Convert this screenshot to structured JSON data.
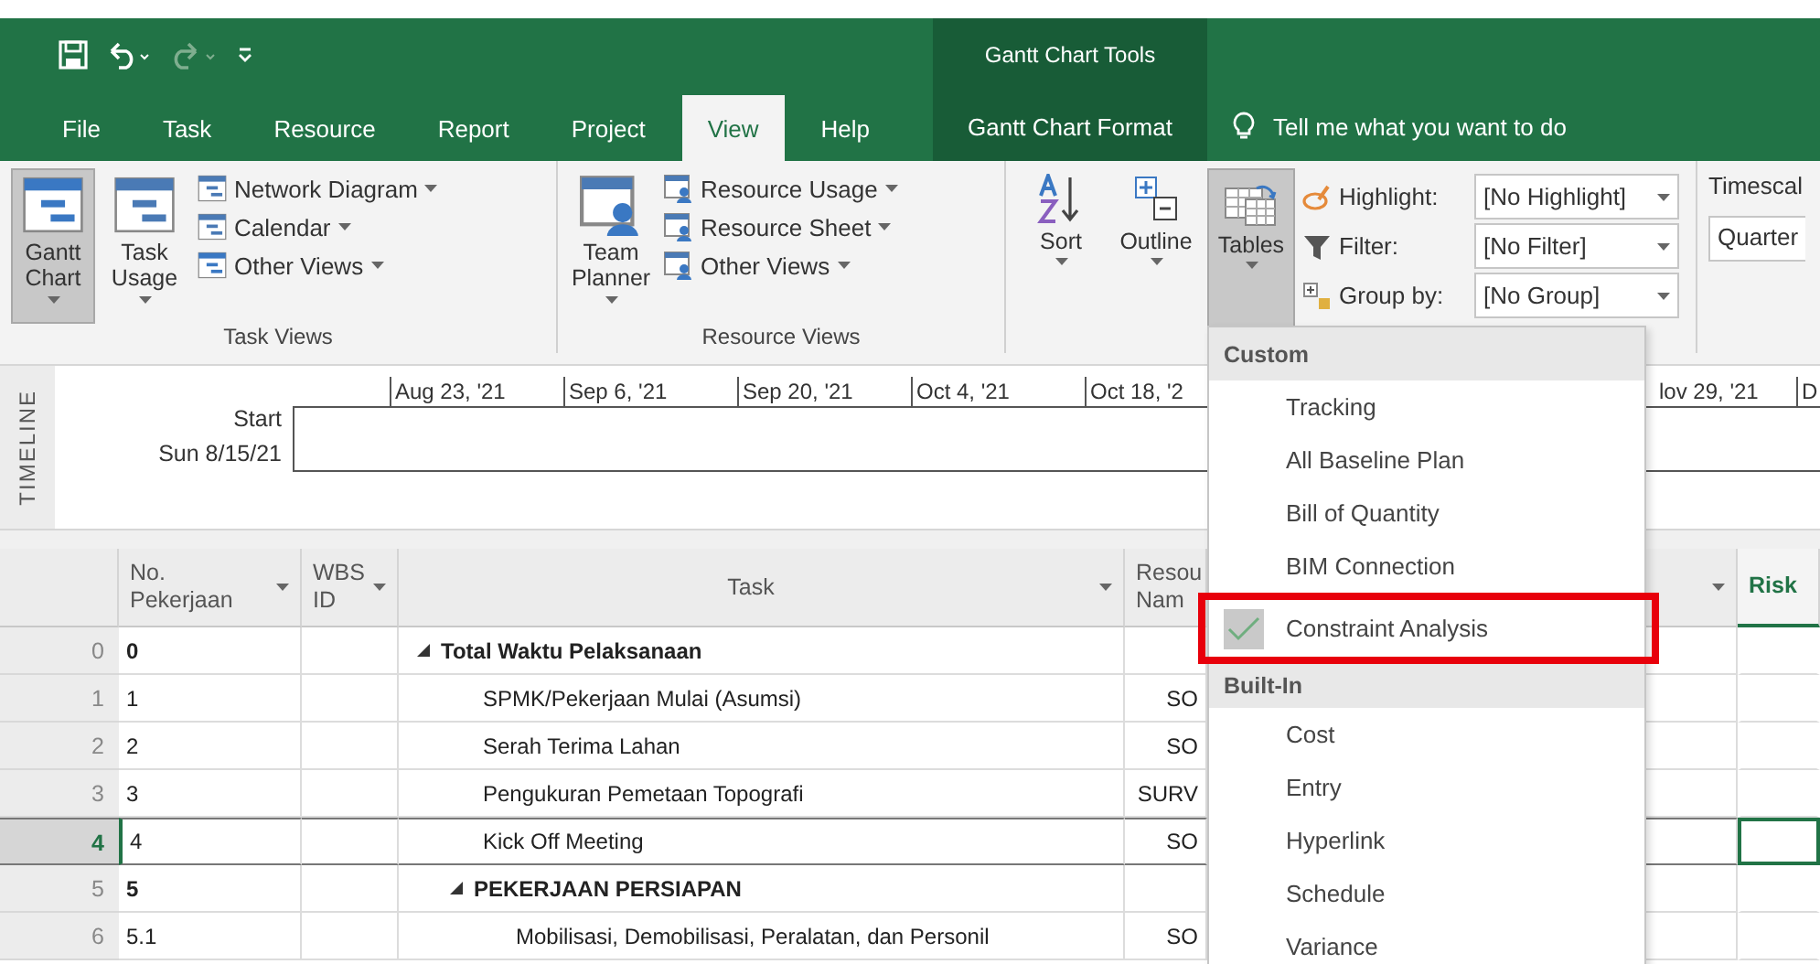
{
  "title_bar": {
    "context_title": "Gantt Chart Tools"
  },
  "tabs": [
    {
      "label": "File",
      "selected": false
    },
    {
      "label": "Task",
      "selected": false
    },
    {
      "label": "Resource",
      "selected": false
    },
    {
      "label": "Report",
      "selected": false
    },
    {
      "label": "Project",
      "selected": false
    },
    {
      "label": "View",
      "selected": true
    },
    {
      "label": "Help",
      "selected": false
    }
  ],
  "context_tab": {
    "label": "Gantt Chart Format",
    "selected": false
  },
  "tell_me": {
    "placeholder": "Tell me what you want to do"
  },
  "ribbon": {
    "groups": [
      {
        "label": "Task Views",
        "columns": [
          {
            "kind": "large",
            "label": "Gantt Chart",
            "selected": true
          },
          {
            "kind": "large",
            "label": "Task Usage",
            "selected": false
          },
          {
            "kind": "stack",
            "items": [
              {
                "label": "Network Diagram"
              },
              {
                "label": "Calendar"
              },
              {
                "label": "Other Views"
              }
            ]
          }
        ]
      },
      {
        "label": "Resource Views",
        "columns": [
          {
            "kind": "large",
            "label": "Team Planner",
            "selected": false
          },
          {
            "kind": "stack",
            "items": [
              {
                "label": "Resource Usage"
              },
              {
                "label": "Resource Sheet"
              },
              {
                "label": "Other Views"
              }
            ]
          }
        ]
      },
      {
        "columns": [
          {
            "kind": "large",
            "label": "Sort",
            "selected": false
          },
          {
            "kind": "large",
            "label": "Outline",
            "selected": false
          },
          {
            "kind": "large",
            "label": "Tables",
            "selected": true
          },
          {
            "kind": "filters",
            "items": [
              {
                "label": "Highlight:",
                "value": "[No Highlight]"
              },
              {
                "label": "Filter:",
                "value": "[No Filter]"
              },
              {
                "label": "Group by:",
                "value": "[No Group]"
              }
            ]
          }
        ]
      },
      {
        "columns": [
          {
            "kind": "timescale",
            "label": "Timescal",
            "value": "Quarter"
          }
        ]
      }
    ]
  },
  "timeline": {
    "side_label": "TIMELINE",
    "start_label": "Start",
    "start_date": "Sun 8/15/21",
    "ticks_left": [
      "Aug 23, '21",
      "Sep 6, '21",
      "Sep 20, '21",
      "Oct 4, '21",
      "Oct 18, '2"
    ],
    "ticks_right": [
      "lov 29, '21",
      "D"
    ]
  },
  "table": {
    "columns": [
      {
        "label": "No. Pekerjaan",
        "filter": true
      },
      {
        "label": "WBS ID",
        "filter": true
      },
      {
        "label": "Task",
        "filter": true
      },
      {
        "label": "Resou Nam",
        "filter": false
      },
      {
        "filter": true
      },
      {
        "label": "Risk",
        "filter": false
      }
    ],
    "rows": [
      {
        "number": "0",
        "no": "0",
        "task": "Total Waktu Pelaksanaan",
        "summary": true,
        "selected": false,
        "children": [
          {
            "number": "1",
            "no": "1",
            "task": "SPMK/Pekerjaan Mulai (Asumsi)",
            "resource": "SO",
            "summary": false,
            "selected": false
          },
          {
            "number": "2",
            "no": "2",
            "task": "Serah Terima Lahan",
            "resource": "SO",
            "summary": false,
            "selected": false
          },
          {
            "number": "3",
            "no": "3",
            "task": "Pengukuran Pemetaan Topografi",
            "resource": "SURV",
            "summary": false,
            "selected": false
          },
          {
            "number": "4",
            "no": "4",
            "task": "Kick Off Meeting",
            "resource": "SO",
            "summary": false,
            "selected": true
          },
          {
            "number": "5",
            "no": "5",
            "task": "PEKERJAAN PERSIAPAN",
            "summary": true,
            "selected": false,
            "children": [
              {
                "number": "6",
                "no": "5.1",
                "task": "Mobilisasi, Demobilisasi, Peralatan, dan Personil",
                "resource": "SO",
                "summary": false,
                "selected": false
              }
            ]
          }
        ]
      }
    ]
  },
  "tables_menu": {
    "sections": [
      {
        "heading": "Custom",
        "items": [
          {
            "label": "Tracking",
            "selected": false
          },
          {
            "label": "All Baseline Plan",
            "selected": false
          },
          {
            "label": "Bill of Quantity",
            "selected": false
          },
          {
            "label": "BIM Connection",
            "selected": false
          },
          {
            "label": "Constraint Analysis",
            "selected": true,
            "highlighted": true
          }
        ]
      },
      {
        "heading": "Built-In",
        "items": [
          {
            "label": "Cost",
            "selected": false
          },
          {
            "label": "Entry",
            "selected": false
          },
          {
            "label": "Hyperlink",
            "selected": false
          },
          {
            "label": "Schedule",
            "selected": false
          },
          {
            "label": "Variance",
            "selected": false
          }
        ]
      }
    ]
  }
}
